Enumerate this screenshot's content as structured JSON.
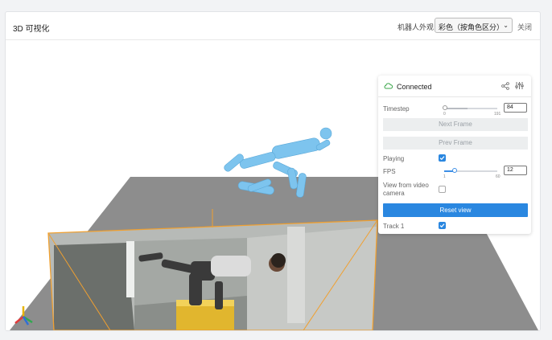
{
  "header": {
    "title": "3D 可视化",
    "appearance_label": "机器人外观",
    "appearance_select": "彩色（按角色区分）",
    "close_label": "关闭"
  },
  "panel": {
    "status": "Connected",
    "timestep": {
      "label": "Timestep",
      "min": "0",
      "max": "191",
      "value": "84"
    },
    "next_frame": "Next Frame",
    "prev_frame": "Prev Frame",
    "playing": {
      "label": "Playing",
      "checked": true
    },
    "fps": {
      "label": "FPS",
      "min": "1",
      "max": "60",
      "value": "12"
    },
    "view_from_camera": {
      "label_line1": "View from video",
      "label_line2": "camera",
      "checked": false
    },
    "reset_view": "Reset view",
    "track": {
      "label": "Track 1",
      "checked": true
    }
  },
  "colors": {
    "accent": "#2a87e0",
    "connected": "#3aa64a",
    "robot": "#7dc4ee",
    "ground": "#8d8d8d",
    "frame_outline": "#f0a030"
  },
  "icons": [
    "cloud-connected-icon",
    "share-icon",
    "tune-icon",
    "chevron-down-icon",
    "axes-gizmo-icon",
    "checkmark-icon"
  ]
}
